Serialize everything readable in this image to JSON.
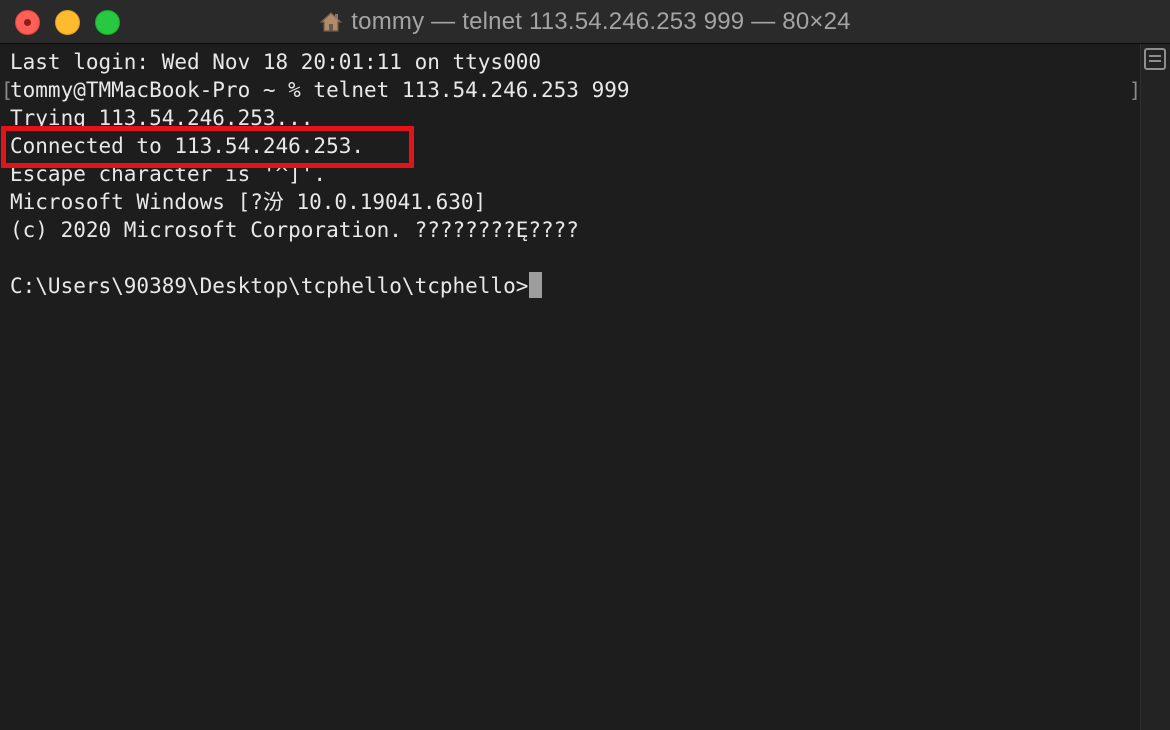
{
  "window": {
    "title": "tommy — telnet 113.54.246.253 999 — 80×24"
  },
  "terminal": {
    "lines": [
      "Last login: Wed Nov 18 20:01:11 on ttys000",
      "tommy@TMMacBook-Pro ~ % telnet 113.54.246.253 999",
      "Trying 113.54.246.253...",
      "Connected to 113.54.246.253.",
      "Escape character is '^]'.",
      "Microsoft Windows [?汾 10.0.19041.630]",
      "(c) 2020 Microsoft Corporation. ????????Ę????",
      "",
      "C:\\Users\\90389\\Desktop\\tcphello\\tcphello>"
    ],
    "mark_left": "[",
    "mark_right": "]"
  },
  "icons": {
    "close": "close-icon",
    "minimize": "minimize-icon",
    "zoom": "zoom-icon",
    "home": "home-icon",
    "scroll": "scrollbar-toggle-icon"
  },
  "colors": {
    "background": "#1d1d1d",
    "text": "#e8e8e8",
    "highlight": "#e4131a",
    "cursor": "#9d9d9d"
  }
}
